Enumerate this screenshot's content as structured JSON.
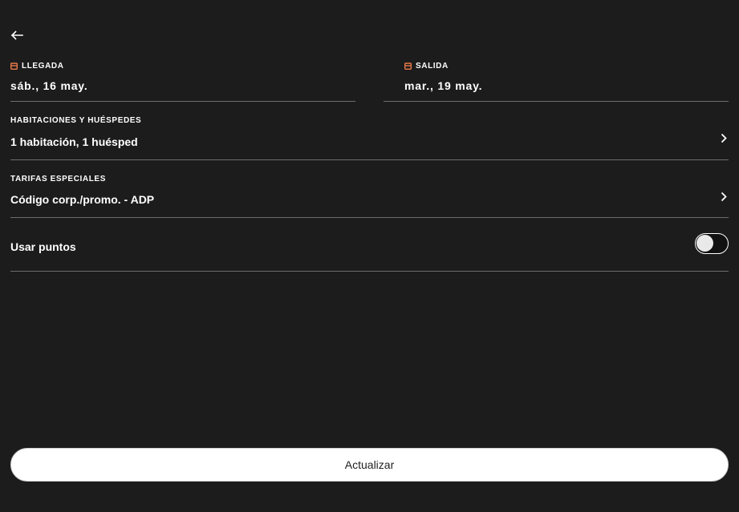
{
  "header": {
    "back_icon": "arrow-left-icon"
  },
  "dates": {
    "arrival": {
      "label": "LLEGADA",
      "value": "sáb., 16 may.",
      "icon": "calendar-icon"
    },
    "departure": {
      "label": "SALIDA",
      "value": "mar., 19 may.",
      "icon": "calendar-icon"
    }
  },
  "rooms": {
    "label": "HABITACIONES Y HUÉSPEDES",
    "value": "1 habitación, 1 huésped",
    "icon": "chevron-right-icon"
  },
  "rates": {
    "label": "TARIFAS ESPECIALES",
    "value": "Código corp./promo. - ADP",
    "icon": "chevron-right-icon"
  },
  "points": {
    "label": "Usar puntos",
    "enabled": false
  },
  "actions": {
    "update_label": "Actualizar"
  },
  "colors": {
    "background": "#1c1c1c",
    "accent": "#e8794a",
    "divider": "#6d6d6d",
    "button_bg": "#ffffff"
  }
}
